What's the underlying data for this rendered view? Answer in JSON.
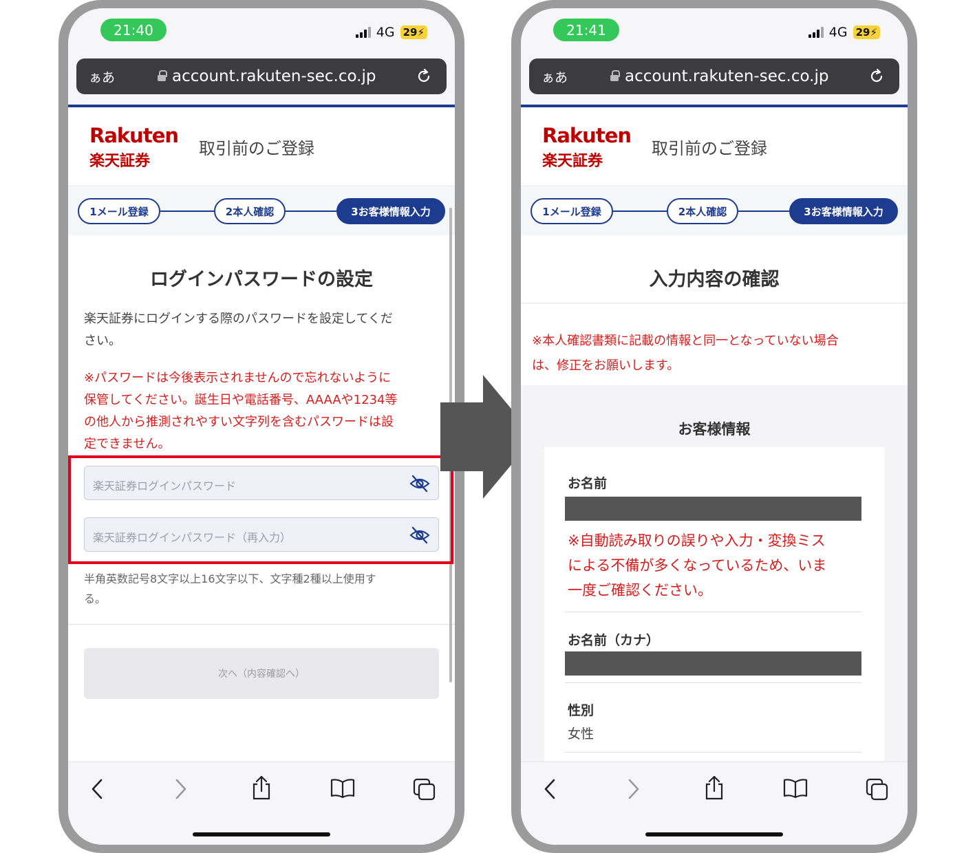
{
  "left": {
    "status": {
      "time": "21:40",
      "network": "4G",
      "battery": "29"
    },
    "urlbar": {
      "aa": "ぁあ",
      "url": "account.rakuten-sec.co.jp"
    },
    "header": {
      "logo_en": "Rakuten",
      "logo_jp": "楽天証券",
      "title": "取引前のご登録"
    },
    "steps": [
      {
        "label": "1メール登録"
      },
      {
        "label": "2本人確認"
      },
      {
        "label": "3お客様情報入力"
      }
    ],
    "heading": "ログインパスワードの設定",
    "intro_line1": "楽天証券にログインする際のパスワードを設定してくだ",
    "intro_line2": "さい。",
    "warning_lines": [
      "※パスワードは今後表示されませんので忘れないように",
      "保管してください。誕生日や電話番号、AAAAや1234等",
      "の他人から推測されやすい文字列を含むパスワードは設",
      "定できません。"
    ],
    "password_placeholder": "楽天証券ログインパスワード",
    "password_confirm_placeholder": "楽天証券ログインパスワード（再入力）",
    "hint_line1": "半角英数記号8文字以上16文字以下、文字種2種以上使用す",
    "hint_line2": "る。",
    "next_button": "次へ（内容確認へ）"
  },
  "right": {
    "status": {
      "time": "21:41",
      "network": "4G",
      "battery": "29"
    },
    "urlbar": {
      "aa": "ぁあ",
      "url": "account.rakuten-sec.co.jp"
    },
    "header": {
      "logo_en": "Rakuten",
      "logo_jp": "楽天証券",
      "title": "取引前のご登録"
    },
    "steps": [
      {
        "label": "1メール登録"
      },
      {
        "label": "2本人確認"
      },
      {
        "label": "3お客様情報入力"
      }
    ],
    "heading": "入力内容の確認",
    "notice_lines": [
      "※本人確認書類に記載の情報と同一となっていない場合",
      "は、修正をお願いします。"
    ],
    "section_title": "お客様情報",
    "name_label": "お名前",
    "name_warning_lines": [
      "※自動読み取りの誤りや入力・変換ミス",
      "による不備が多くなっているため、いま",
      "一度ご確認ください。"
    ],
    "kana_label": "お名前（カナ）",
    "gender_label": "性別",
    "gender_value": "女性"
  },
  "colors": {
    "brand_red": "#bf0000",
    "step_blue": "#1d3b8f",
    "warning_red": "#d61d1d",
    "highlight": "#e3001b",
    "arrow": "#555555"
  }
}
